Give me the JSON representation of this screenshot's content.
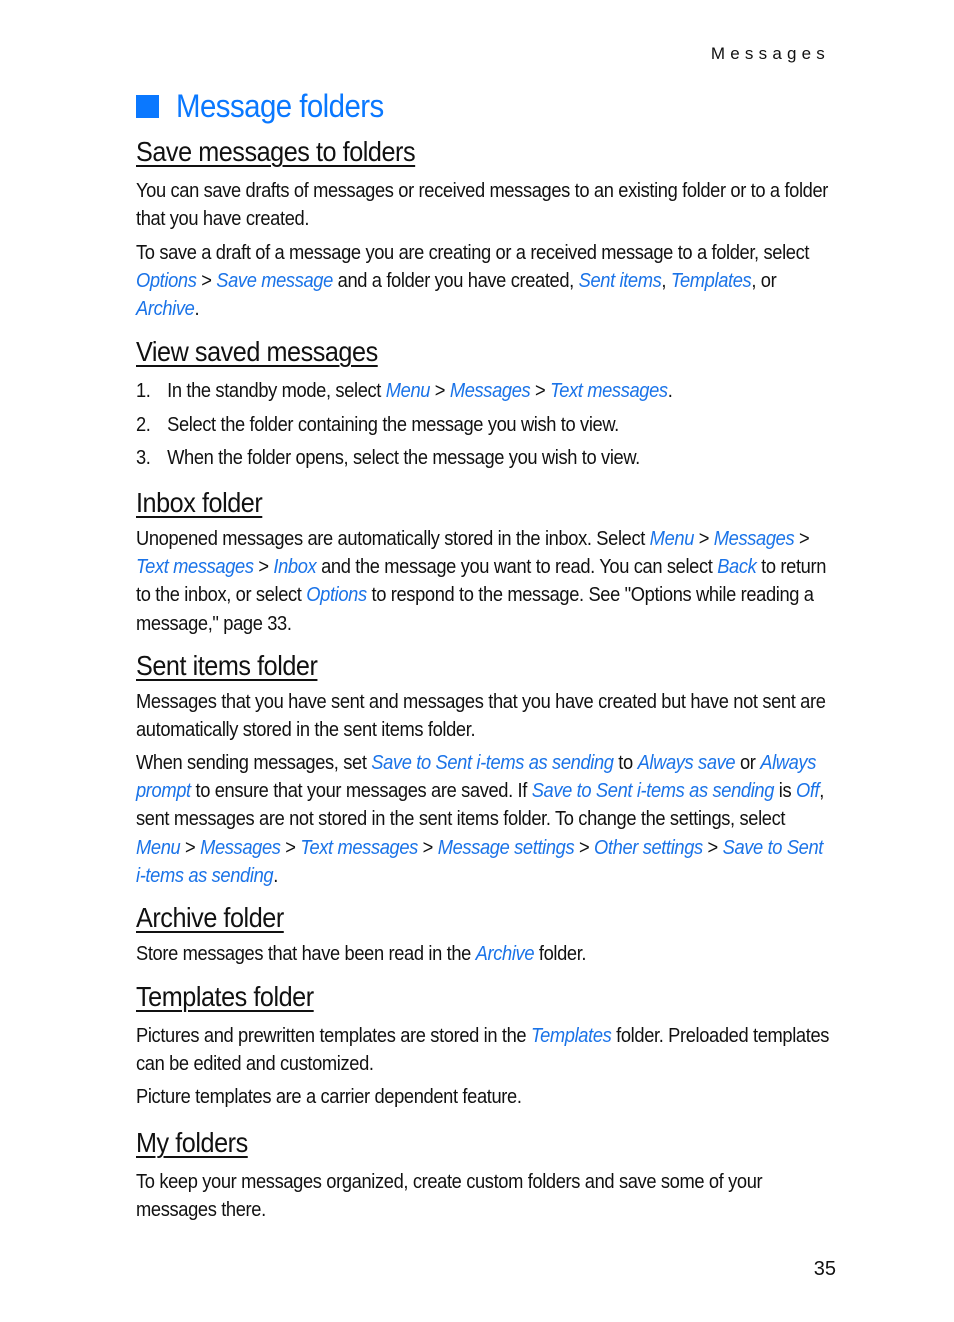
{
  "header": {
    "running_head": "Messages"
  },
  "title": "Message folders",
  "accent_color": "#0a78ff",
  "link_color": "#1a73e8",
  "sections": {
    "save": {
      "heading": "Save messages to folders",
      "p1": "You can save drafts of messages or received messages to an existing folder or to a folder that you have created.",
      "p2_a": "To save a draft of a message you are creating or a received message to a folder, select ",
      "p2_link1": "Options",
      "p2_sep1": " > ",
      "p2_link2": "Save message",
      "p2_b": " and a folder you have created, ",
      "p2_link3": "Sent items",
      "p2_c": ", ",
      "p2_link4": "Templates",
      "p2_d": ", or ",
      "p2_link5": "Archive",
      "p2_e": "."
    },
    "view": {
      "heading": "View saved messages",
      "steps": [
        {
          "num": "1.",
          "text_a": "In the standby mode, select ",
          "link1": "Menu",
          "sep1": " > ",
          "link2": "Messages",
          "sep2": " > ",
          "link3": "Text messages",
          "end": "."
        },
        {
          "num": "2.",
          "text": "Select the folder containing the message you wish to view."
        },
        {
          "num": "3.",
          "text": "When the folder opens, select the message you wish to view."
        }
      ]
    },
    "inbox": {
      "heading": "Inbox folder",
      "a": "Unopened messages are automatically stored in the inbox. Select ",
      "l1": "Menu",
      "s1": " > ",
      "l2": "Messages",
      "s2": " > ",
      "l3": "Text messages",
      "s3": " > ",
      "l4": "Inbox",
      "b": " and the message you want to read. You can select ",
      "l5": "Back",
      "c": " to return to the inbox, or select ",
      "l6": "Options",
      "d": " to respond to the message. See \"Options while reading a message,\" page 33."
    },
    "sent": {
      "heading": "Sent items folder",
      "p1": "Messages that you have sent and messages that you have created but have not sent are automatically stored in the sent items folder.",
      "a": "When sending messages, set ",
      "l1": "Save to Sent i-tems as sending",
      "b": " to ",
      "l2": "Always save",
      "c": " or ",
      "l3": "Always prompt",
      "d": " to ensure that your messages are saved. If ",
      "l4": "Save to Sent i-tems as sending",
      "e": " is ",
      "l5": "Off",
      "f": ", sent messages are not stored in the sent items folder. To change the settings, select ",
      "l6": "Menu",
      "s1": " > ",
      "l7": "Messages",
      "s2": " > ",
      "l8": "Text messages",
      "s3": " > ",
      "l9": "Message settings",
      "s4": " > ",
      "l10": "Other settings",
      "s5": " > ",
      "l11": "Save to Sent i-tems as sending",
      "g": "."
    },
    "archive": {
      "heading": "Archive folder",
      "a": "Store messages that have been read in the ",
      "l1": "Archive",
      "b": " folder."
    },
    "templates": {
      "heading": "Templates folder",
      "a": "Pictures and prewritten templates are stored in the ",
      "l1": "Templates",
      "b": " folder. Preloaded templates can be edited and customized.",
      "p2": "Picture templates are a carrier dependent feature."
    },
    "myfolders": {
      "heading": "My folders",
      "p1": "To keep your messages organized, create custom folders and save some of your messages there."
    }
  },
  "footer": {
    "page_number": "35"
  }
}
